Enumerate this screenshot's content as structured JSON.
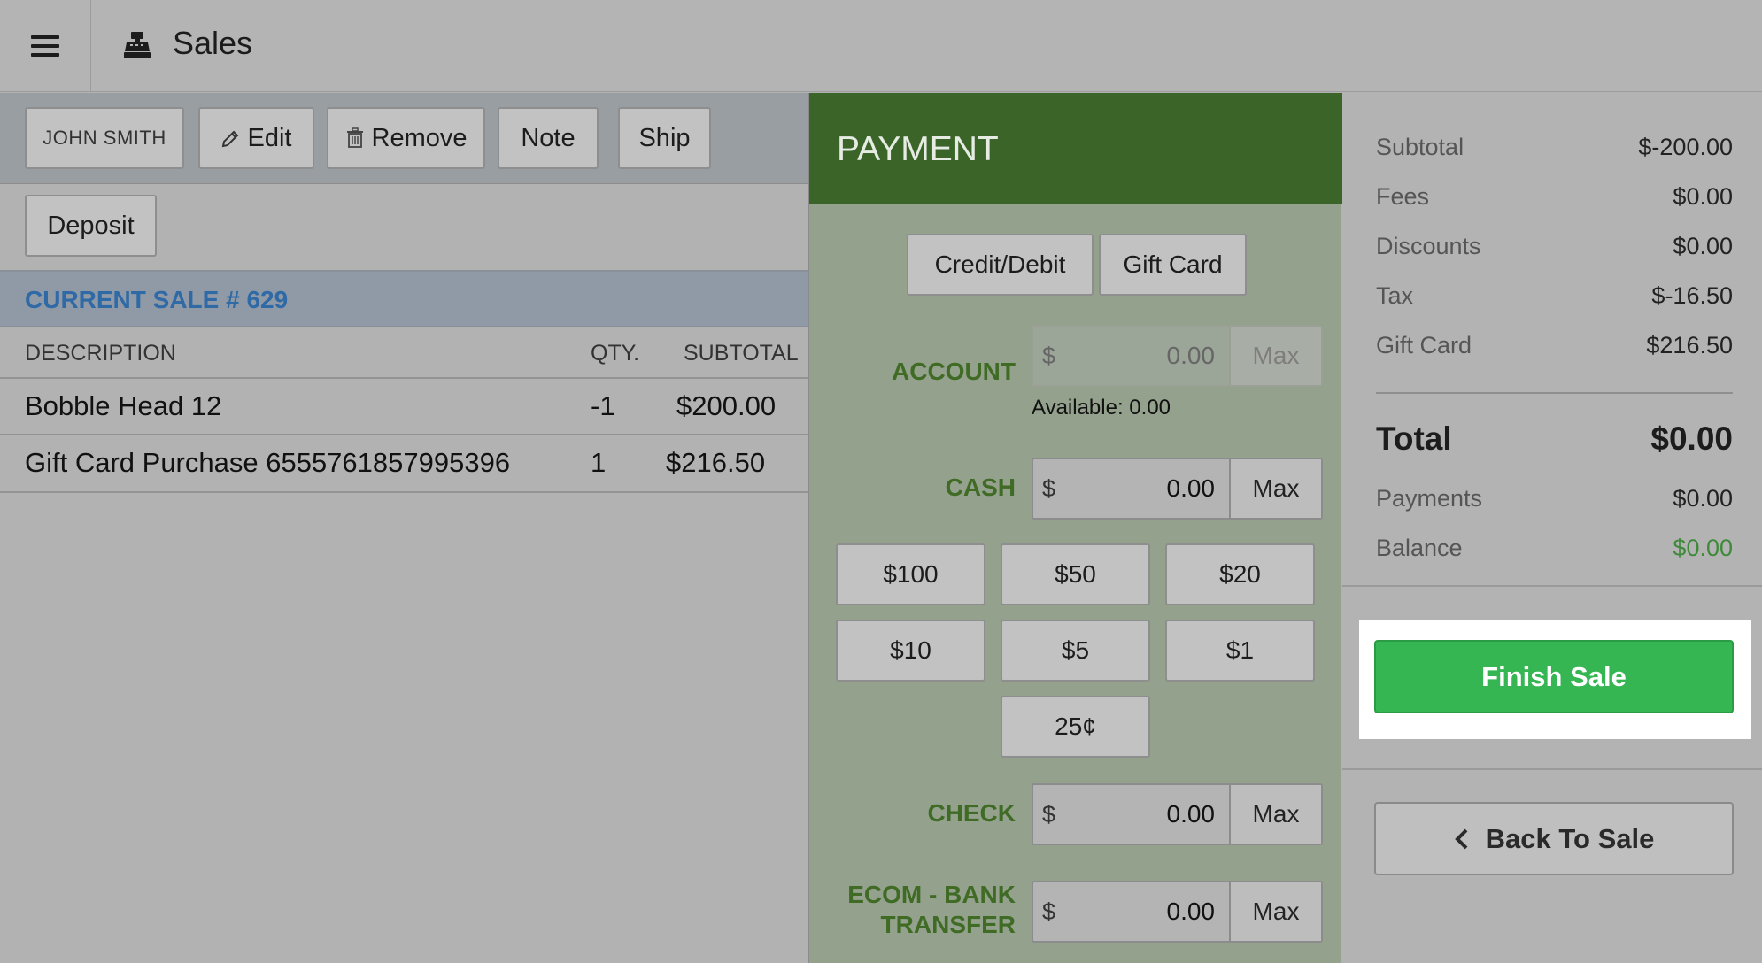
{
  "header": {
    "title": "Sales",
    "menu_icon": "hamburger-icon",
    "app_icon": "cash-register-icon"
  },
  "customer_bar": {
    "customer": "JOHN SMITH",
    "edit": "Edit",
    "remove": "Remove",
    "note": "Note",
    "ship": "Ship",
    "deposit": "Deposit"
  },
  "sale": {
    "title": "CURRENT SALE # 629",
    "columns": {
      "description": "DESCRIPTION",
      "qty": "QTY.",
      "subtotal": "SUBTOTAL"
    },
    "items": [
      {
        "description": "Bobble Head 12",
        "qty": "-1",
        "subtotal": "$200.00"
      },
      {
        "description": "Gift Card Purchase 6555761857995396",
        "qty": "1",
        "subtotal": "$216.50"
      }
    ]
  },
  "payment": {
    "title": "PAYMENT",
    "methods": {
      "credit": "Credit/Debit",
      "gift": "Gift Card"
    },
    "currency": "$",
    "max": "Max",
    "account": {
      "label": "ACCOUNT",
      "value": "0.00",
      "available": "Available: 0.00"
    },
    "cash": {
      "label": "CASH",
      "value": "0.00"
    },
    "quick_cash": [
      "$100",
      "$50",
      "$20",
      "$10",
      "$5",
      "$1",
      "25¢"
    ],
    "check": {
      "label": "CHECK",
      "value": "0.00"
    },
    "ecom": {
      "label_line1": "ECOM - BANK",
      "label_line2": "TRANSFER",
      "value": "0.00"
    }
  },
  "summary": {
    "subtotal_label": "Subtotal",
    "subtotal": "$-200.00",
    "fees_label": "Fees",
    "fees": "$0.00",
    "discounts_label": "Discounts",
    "discounts": "$0.00",
    "tax_label": "Tax",
    "tax": "$-16.50",
    "gift_label": "Gift Card",
    "gift": "$216.50",
    "total_label": "Total",
    "total": "$0.00",
    "payments_label": "Payments",
    "payments": "$0.00",
    "balance_label": "Balance",
    "balance": "$0.00",
    "balance_color": "#3f8a3a",
    "finish": "Finish Sale",
    "back": "Back To Sale"
  }
}
